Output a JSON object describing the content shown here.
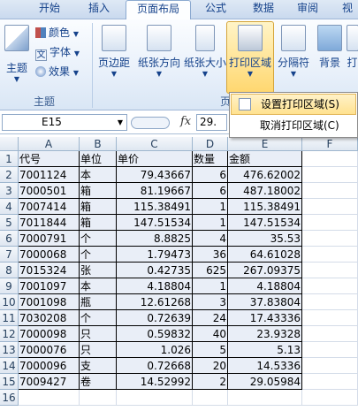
{
  "ribbon_tabs": [
    {
      "label": "开始"
    },
    {
      "label": "插入"
    },
    {
      "label": "页面布局"
    },
    {
      "label": "公式"
    },
    {
      "label": "数据"
    },
    {
      "label": "审阅"
    },
    {
      "label": "视"
    }
  ],
  "theme_group": {
    "label": "主题",
    "themes_label": "主题",
    "colors_label": "颜色",
    "fonts_label": "字体",
    "effects_label": "效果"
  },
  "page_setup_group": {
    "label": "页",
    "buttons": [
      {
        "label": "页边距"
      },
      {
        "label": "纸张方向"
      },
      {
        "label": "纸张大小"
      },
      {
        "label": "打印区域"
      },
      {
        "label": "分隔符"
      },
      {
        "label": "背景"
      },
      {
        "label": "打"
      }
    ]
  },
  "print_area_menu": {
    "items": [
      {
        "label": "设置打印区域(S)"
      },
      {
        "label": "取消打印区域(C)"
      }
    ]
  },
  "formula_bar": {
    "name_box": "E15",
    "fx": "fx",
    "value": "29."
  },
  "sheet": {
    "columns": [
      "A",
      "B",
      "C",
      "D",
      "E",
      "F"
    ],
    "rows": [
      [
        "代号",
        "单位",
        "单价",
        "数量",
        "金额"
      ],
      [
        "7001124",
        "本",
        "79.43667",
        "6",
        "476.62002"
      ],
      [
        "7000501",
        "箱",
        "81.19667",
        "6",
        "487.18002"
      ],
      [
        "7007414",
        "箱",
        "115.38491",
        "1",
        "115.38491"
      ],
      [
        "7011844",
        "箱",
        "147.51534",
        "1",
        "147.51534"
      ],
      [
        "7000791",
        "个",
        "8.8825",
        "4",
        "35.53"
      ],
      [
        "7000068",
        "个",
        "1.79473",
        "36",
        "64.61028"
      ],
      [
        "7015324",
        "张",
        "0.42735",
        "625",
        "267.09375"
      ],
      [
        "7001097",
        "本",
        "4.18804",
        "1",
        "4.18804"
      ],
      [
        "7001098",
        "瓶",
        "12.61268",
        "3",
        "37.83804"
      ],
      [
        "7030208",
        "个",
        "0.72639",
        "24",
        "17.43336"
      ],
      [
        "7000098",
        "只",
        "0.59832",
        "40",
        "23.9328"
      ],
      [
        "7000076",
        "只",
        "1.026",
        "5",
        "5.13"
      ],
      [
        "7000096",
        "支",
        "0.72668",
        "20",
        "14.5336"
      ],
      [
        "7009427",
        "卷",
        "14.52992",
        "2",
        "29.05984"
      ]
    ],
    "row_numbers": [
      "1",
      "2",
      "3",
      "4",
      "5",
      "6",
      "7",
      "8",
      "9",
      "10",
      "11",
      "12",
      "13",
      "14",
      "15",
      "16"
    ]
  }
}
